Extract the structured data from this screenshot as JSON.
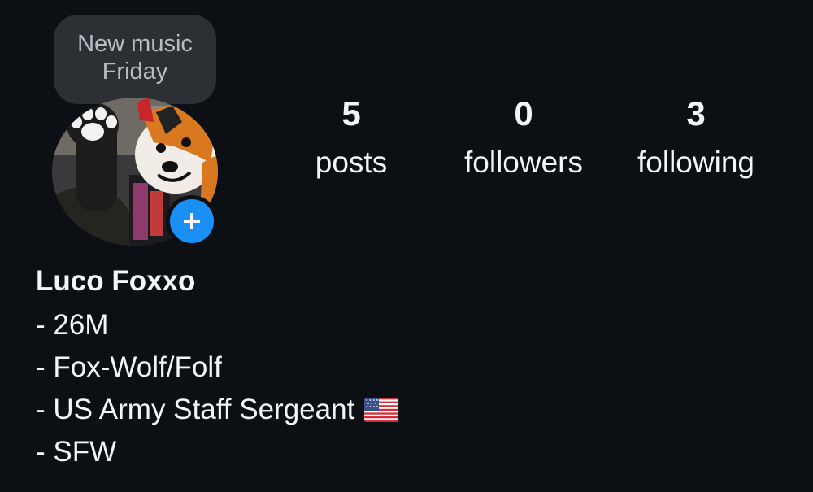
{
  "note": {
    "line1": "New music",
    "line2": "Friday"
  },
  "avatar": {
    "icon": "profile-photo-fursuit",
    "add_story_icon": "plus-icon",
    "add_story_color": "#1a8ff5"
  },
  "stats": {
    "posts": {
      "count": "5",
      "label": "posts"
    },
    "followers": {
      "count": "0",
      "label": "followers"
    },
    "following": {
      "count": "3",
      "label": "following"
    }
  },
  "profile": {
    "name": "Luco Foxxo",
    "bio": [
      "- 26M",
      "- Fox-Wolf/Folf",
      "- US Army Staff Sergeant",
      "- SFW"
    ],
    "bio_emoji_icon": "us-flag-icon"
  },
  "colors": {
    "background": "#0c0f14",
    "bubble": "#2c2f34",
    "text": "#f4f5f7",
    "accent": "#1a8ff5"
  }
}
